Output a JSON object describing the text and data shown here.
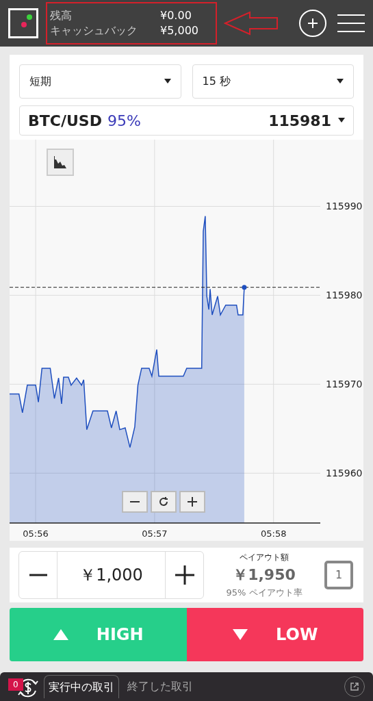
{
  "header": {
    "balance_label": "残高",
    "balance_value": "¥0.00",
    "cashback_label": "キャッシュバック",
    "cashback_value": "¥5,000"
  },
  "selectors": {
    "option_type": "短期",
    "duration": "15 秒",
    "asset": "BTC/USD",
    "asset_rate": "95%",
    "asset_price": "115981"
  },
  "chart": {
    "chart_data": {
      "type": "area",
      "x": [
        355.781,
        355.86,
        355.889,
        355.93,
        356,
        356.023,
        356.053,
        356.123,
        356.158,
        356.193,
        356.218,
        356.235,
        356.275,
        356.298,
        356.344,
        356.386,
        356.404,
        356.43,
        356.482,
        356.604,
        356.637,
        356.677,
        356.707,
        356.753,
        356.793,
        356.833,
        356.86,
        356.891,
        356.954,
        356.977,
        357.018,
        357.035,
        357.242,
        357.27,
        357.396,
        357.409,
        357.426,
        357.439,
        357.456,
        357.467,
        357.484,
        357.53,
        357.553,
        357.598,
        357.689,
        357.702,
        357.742,
        357.754
      ],
      "series": [
        {
          "color": "#1f4fbf",
          "values": [
            115968.9,
            115968.9,
            115966.8,
            115969.9,
            115969.9,
            115968,
            115971.8,
            115971.8,
            115968.4,
            115970.7,
            115967.8,
            115970.8,
            115970.8,
            115969.9,
            115970.7,
            115969.9,
            115970.5,
            115964.9,
            115967,
            115967,
            115965.1,
            115967,
            115964.9,
            115965.1,
            115962.9,
            115965.2,
            115969.9,
            115971.8,
            115971.8,
            115970.9,
            115973.9,
            115970.9,
            115970.9,
            115971.8,
            115971.8,
            115987.2,
            115988.9,
            115979.9,
            115978.4,
            115980.7,
            115977.8,
            115979.9,
            115977.8,
            115978.9,
            115978.9,
            115977.8,
            115977.8,
            115980.9
          ]
        }
      ],
      "xlim": [
        355.781,
        358.393
      ],
      "ylim": [
        115954.4,
        115997.5
      ],
      "xticks": [
        {
          "value": 356,
          "label": "05:56"
        },
        {
          "value": 357,
          "label": "05:57"
        },
        {
          "value": 358,
          "label": "05:58"
        }
      ],
      "yticks": [
        115960,
        115970,
        115980,
        115990
      ],
      "grid": true,
      "ref_lines": [
        {
          "axis": "y",
          "value": 115980.9
        }
      ]
    }
  },
  "trade": {
    "amount": "￥1,000",
    "payout_label": "ペイアウト額",
    "payout_value": "￥1,950",
    "payout_rate": "95% ペイアウト率",
    "count": "1"
  },
  "actions": [
    {
      "kind": "high",
      "label": "HIGH"
    },
    {
      "kind": "low",
      "label": "LOW"
    }
  ],
  "footer": {
    "badge": "0",
    "tabs": [
      {
        "label": "実行中の取引",
        "selected": true
      },
      {
        "label": "終了した取引",
        "selected": false
      }
    ]
  }
}
